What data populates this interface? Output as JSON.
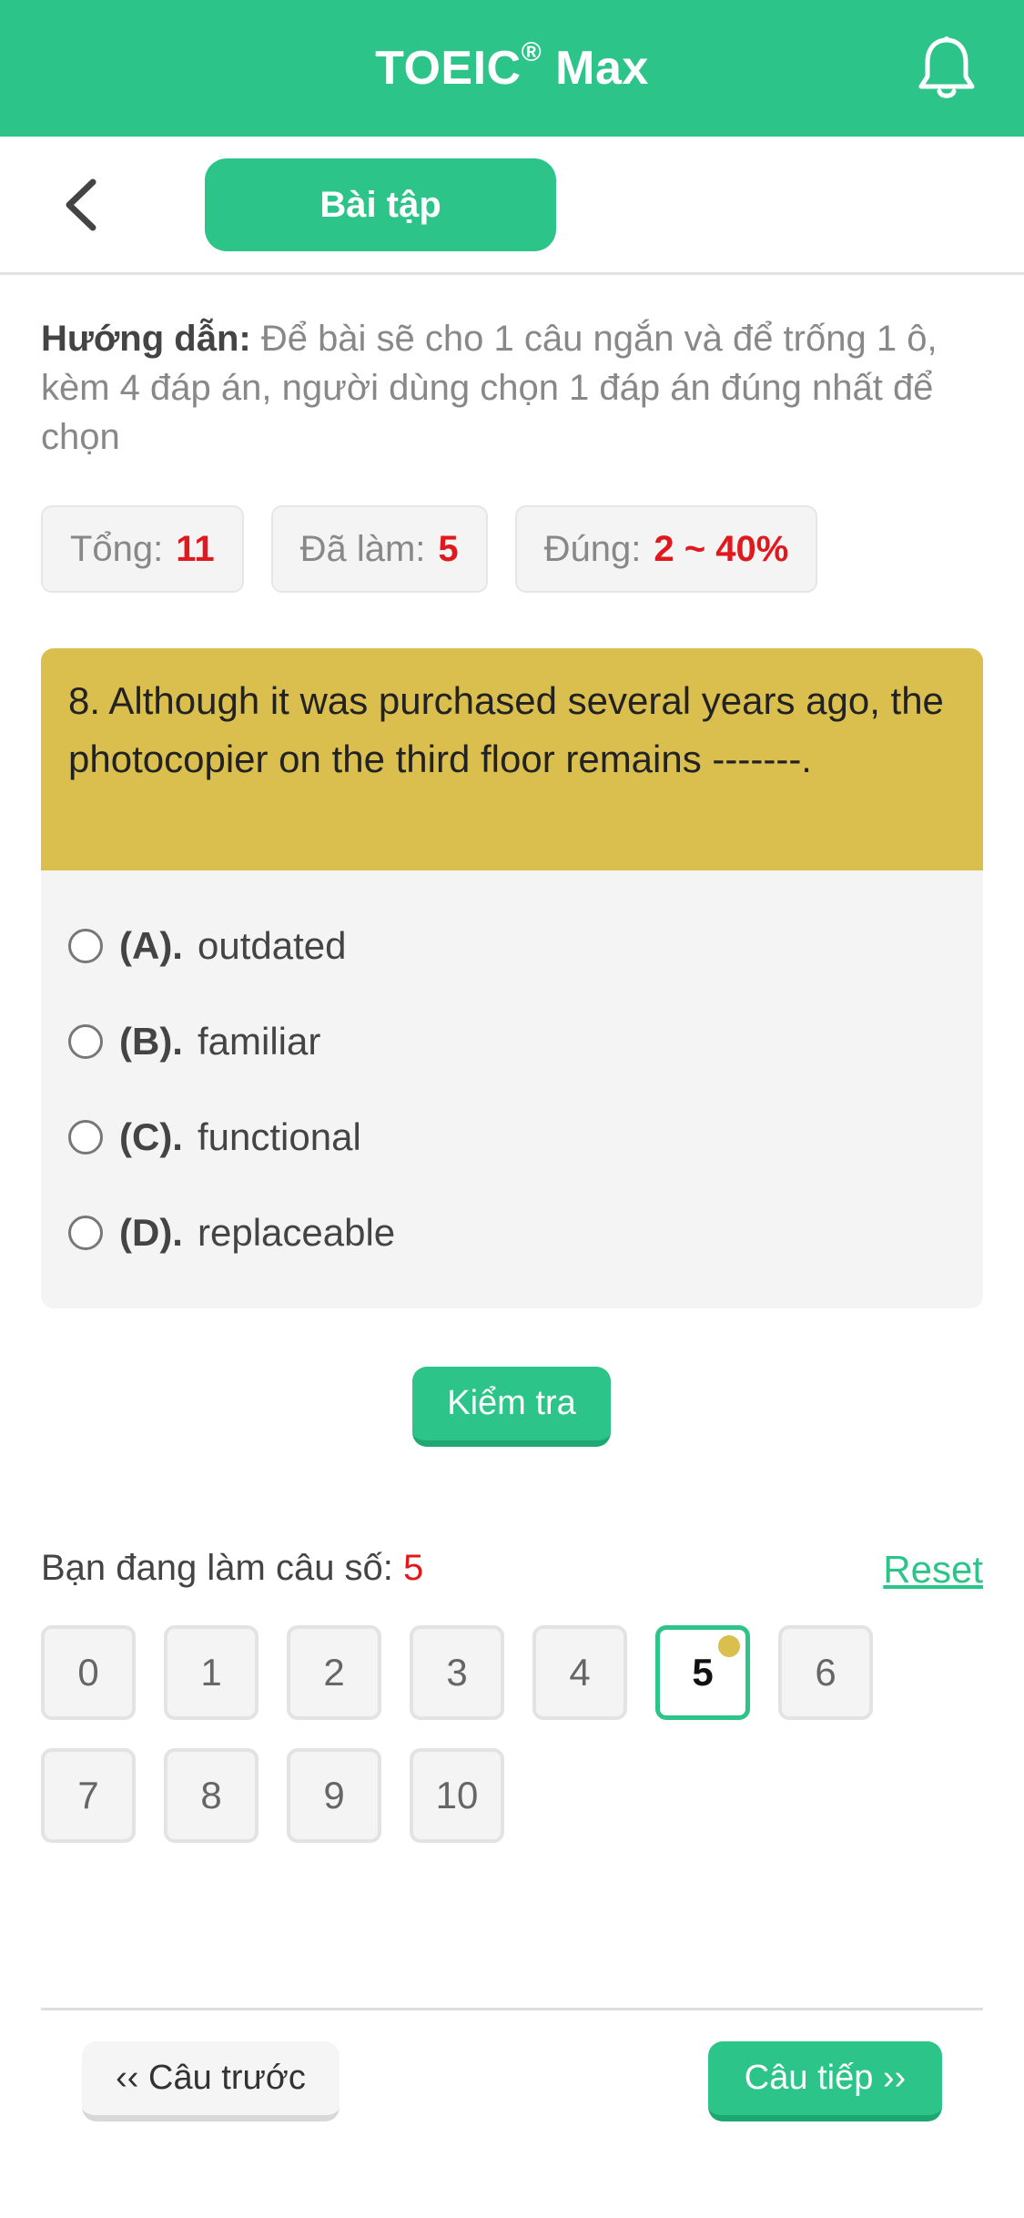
{
  "app": {
    "title": "TOEIC",
    "title_mark": "®",
    "title_suffix": " Max"
  },
  "subnav": {
    "tab_label": "Bài tập"
  },
  "guide": {
    "label": "Hướng dẫn:",
    "text": " Để bài sẽ cho 1 câu ngắn và để trống 1 ô, kèm 4 đáp án, người dùng chọn 1 đáp án đúng nhất để chọn"
  },
  "stats": {
    "total_label": "Tổng:",
    "total_value": "11",
    "done_label": "Đã làm:",
    "done_value": "5",
    "correct_label": "Đúng:",
    "correct_value": "2 ~ 40%"
  },
  "question": {
    "text": "8. Although it was purchased several years ago, the photocopier on the third floor remains -------.",
    "options": [
      {
        "key": "(A).",
        "text": "outdated"
      },
      {
        "key": "(B).",
        "text": "familiar"
      },
      {
        "key": "(C).",
        "text": "functional"
      },
      {
        "key": "(D).",
        "text": "replaceable"
      }
    ]
  },
  "check_button": "Kiểm tra",
  "progress": {
    "label": "Bạn đang làm câu số:",
    "current": "5",
    "reset_label": "Reset"
  },
  "question_numbers": [
    "0",
    "1",
    "2",
    "3",
    "4",
    "5",
    "6",
    "7",
    "8",
    "9",
    "10"
  ],
  "current_index": 5,
  "footer": {
    "prev_label": "‹‹ Câu trước",
    "next_label": "Câu tiếp ››"
  },
  "colors": {
    "primary": "#2dc48a",
    "question_bg": "#dbbf4e",
    "highlight": "#e0191e"
  }
}
